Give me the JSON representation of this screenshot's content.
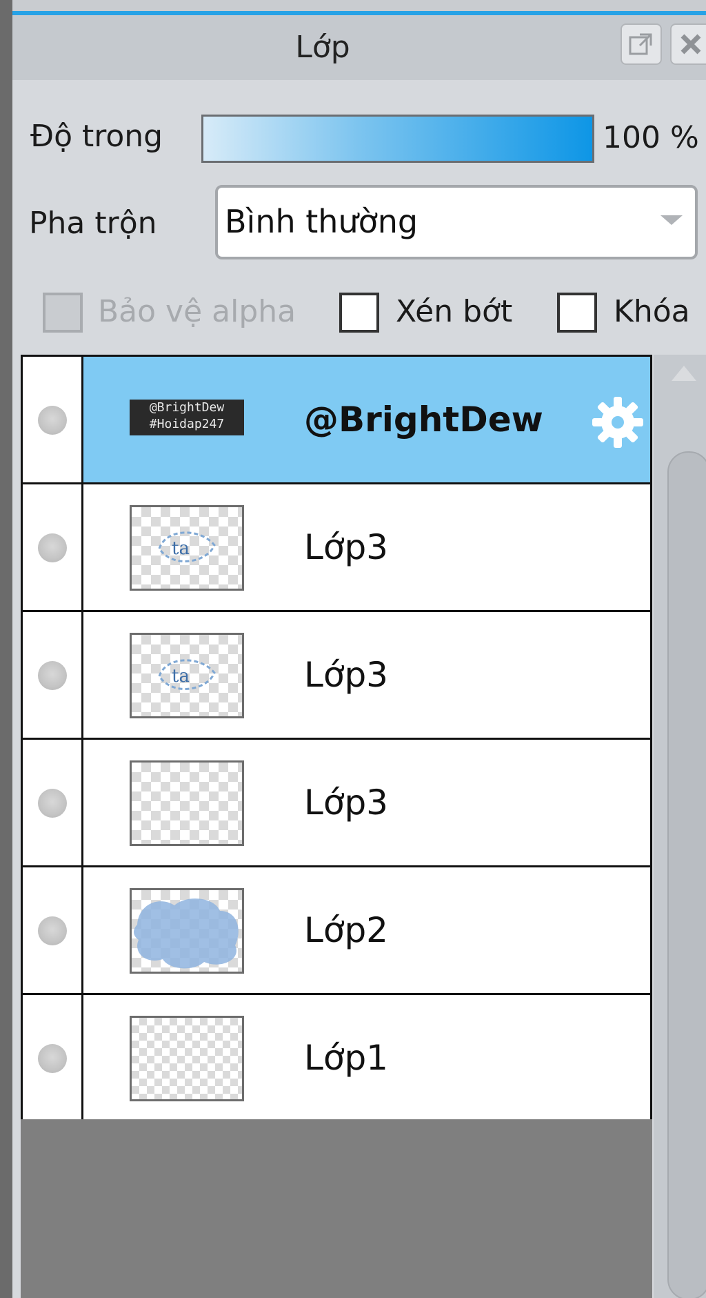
{
  "panel": {
    "title": "Lớp",
    "opacity": {
      "label": "Độ trong",
      "value": "100 %",
      "level_percent": 100
    },
    "blend": {
      "label": "Pha trộn",
      "selected": "Bình thường"
    },
    "options": [
      {
        "label": "Bảo vệ alpha",
        "checked": false,
        "enabled": false
      },
      {
        "label": "Xén bớt",
        "checked": false,
        "enabled": true
      },
      {
        "label": "Khóa",
        "checked": false,
        "enabled": true
      }
    ],
    "layers": [
      {
        "name": "@BrightDew",
        "selected": true,
        "thumb_text": "@BrightDew\n#Hoidap247"
      },
      {
        "name": "Lớp3",
        "selected": false
      },
      {
        "name": "Lớp3",
        "selected": false
      },
      {
        "name": "Lớp3",
        "selected": false
      },
      {
        "name": "Lớp2",
        "selected": false
      },
      {
        "name": "Lớp1",
        "selected": false
      }
    ]
  },
  "colors": {
    "accent": "#27a2e6",
    "selected_row": "#7fcaf3"
  },
  "icons": [
    "popout-icon",
    "close-icon",
    "dropdown-caret-icon",
    "gear-icon",
    "visibility-dot-icon",
    "scroll-up-icon"
  ]
}
